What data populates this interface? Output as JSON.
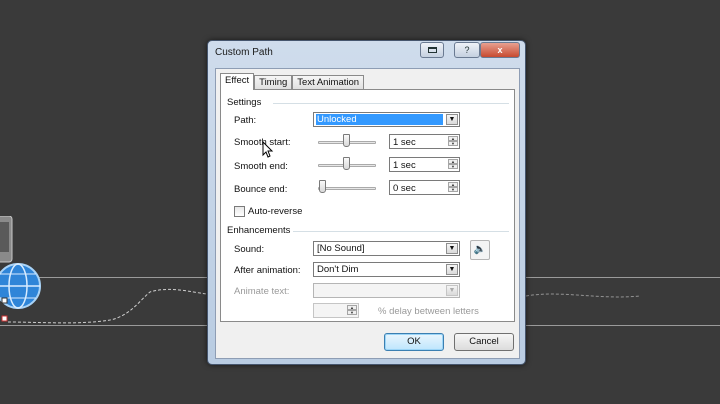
{
  "dialog": {
    "title": "Custom Path",
    "tabs": [
      {
        "label": "Effect",
        "active": true
      },
      {
        "label": "Timing",
        "active": false
      },
      {
        "label": "Text Animation",
        "active": false
      }
    ],
    "settings": {
      "group_label": "Settings",
      "path_label": "Path:",
      "path_value": "Unlocked",
      "smooth_start_label": "Smooth start:",
      "smooth_start_value": "1 sec",
      "smooth_start_level": 0.5,
      "smooth_end_label": "Smooth end:",
      "smooth_end_value": "1 sec",
      "smooth_end_level": 0.5,
      "bounce_end_label": "Bounce end:",
      "bounce_end_value": "0 sec",
      "bounce_end_level": 0.0,
      "auto_reverse_label": "Auto-reverse",
      "auto_reverse_checked": false
    },
    "enhancements": {
      "group_label": "Enhancements",
      "sound_label": "Sound:",
      "sound_value": "[No Sound]",
      "after_animation_label": "After animation:",
      "after_animation_value": "Don't Dim",
      "animate_text_label": "Animate text:",
      "animate_text_value": "",
      "delay_value": "",
      "delay_suffix": "% delay between letters"
    },
    "ok_label": "OK",
    "cancel_label": "Cancel"
  },
  "icons": {
    "help": "?",
    "close": "x",
    "dropdown": "▼",
    "speaker": "🔈"
  }
}
